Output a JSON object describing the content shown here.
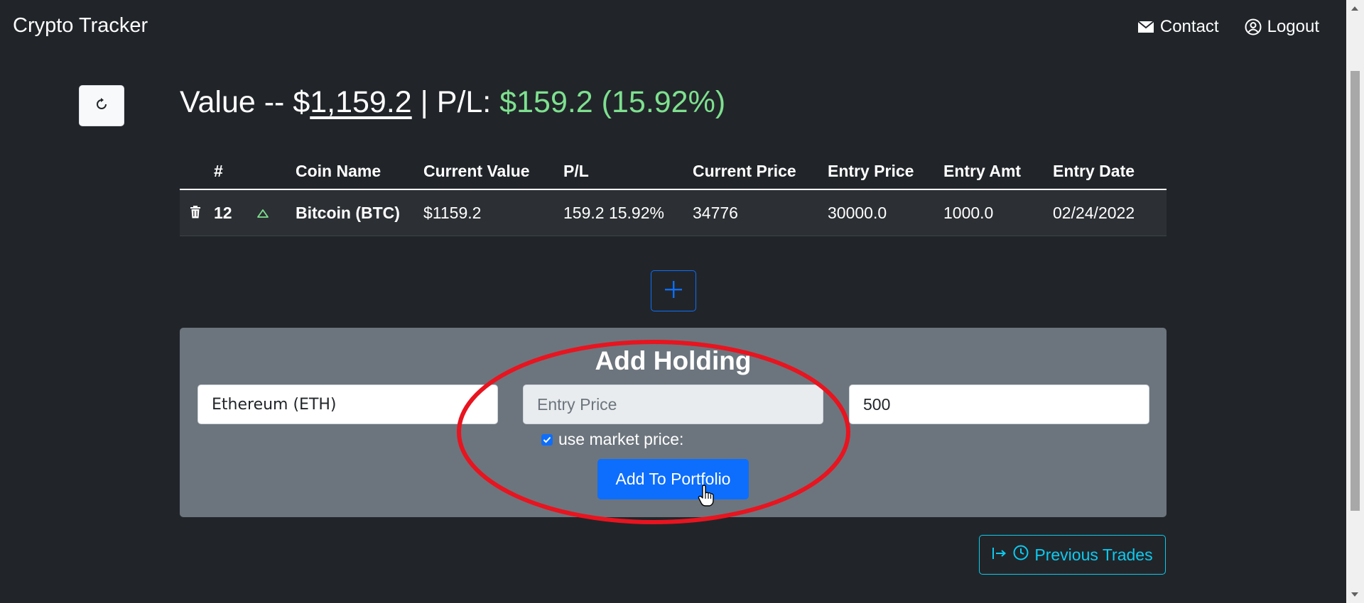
{
  "navbar": {
    "brand": "Crypto Tracker",
    "contact_label": "Contact",
    "logout_label": "Logout"
  },
  "summary": {
    "value_prefix": "Value -- $",
    "value": "1,159.2",
    "pl_label": " | P/L: ",
    "pl_value": "$159.2 (15.92%)"
  },
  "table": {
    "headers": [
      "#",
      "Coin Name",
      "Current Value",
      "P/L",
      "Current Price",
      "Entry Price",
      "Entry Amt",
      "Entry Date"
    ],
    "rows": [
      {
        "id": "12",
        "coin": "Bitcoin (BTC)",
        "current_value": "$1159.2",
        "pl": "159.2 15.92%",
        "current_price": "34776",
        "entry_price": "30000.0",
        "entry_amt": "1000.0",
        "entry_date": "02/24/2022"
      }
    ]
  },
  "add_holding": {
    "title": "Add Holding",
    "coin_value": "Ethereum (ETH)",
    "entry_price_placeholder": "Entry Price",
    "amount_value": "500",
    "checkbox_label": "use market price:",
    "checkbox_checked": true,
    "submit_label": "Add To Portfolio"
  },
  "previous_trades_label": "Previous Trades",
  "colors": {
    "background": "#212529",
    "panel": "#6c757d",
    "primary": "#0d6efd",
    "profit": "#7ee08f",
    "info": "#0dcaf0",
    "annotation": "#e8141f"
  },
  "icons": [
    "envelope-icon",
    "user-circle-icon",
    "refresh-icon",
    "trash-icon",
    "triangle-up-icon",
    "plus-icon",
    "sign-in-icon",
    "clock-icon",
    "hand-pointer-icon"
  ]
}
